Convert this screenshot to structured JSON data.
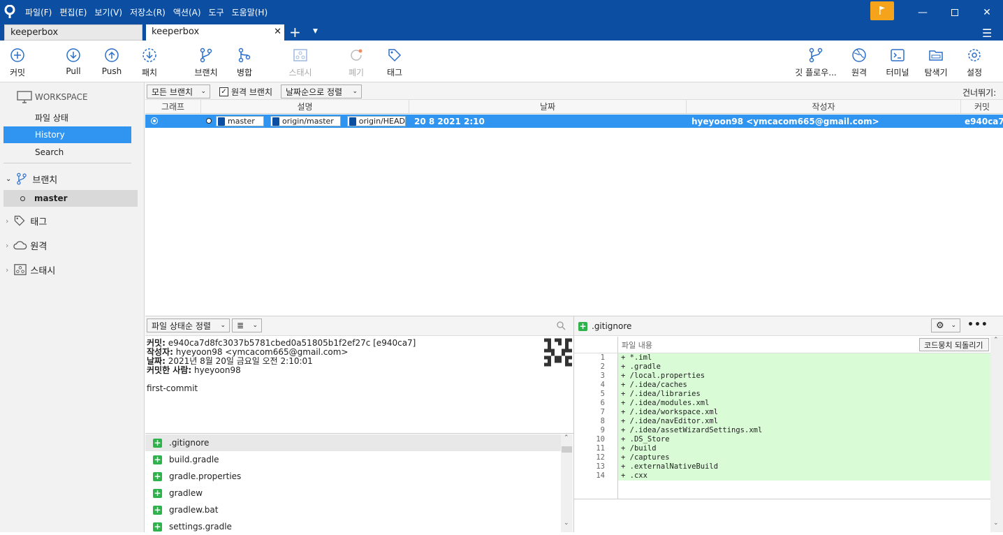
{
  "menu": [
    "파일(F)",
    "편집(E)",
    "보기(V)",
    "저장소(R)",
    "액션(A)",
    "도구",
    "도움말(H)"
  ],
  "tabs": [
    {
      "label": "keeperbox"
    },
    {
      "label": "keeperbox"
    }
  ],
  "toolbar": {
    "commit": "커밋",
    "pull": "Pull",
    "push": "Push",
    "patch": "패치",
    "branch": "브랜치",
    "merge": "병합",
    "stash": "스태시",
    "discard": "폐기",
    "tag": "태그",
    "gitflow": "깃 플로우...",
    "remote": "원격",
    "terminal": "터미널",
    "explorer": "탐색기",
    "settings": "설정"
  },
  "sidebar": {
    "workspace": "WORKSPACE",
    "file_status": "파일 상태",
    "history": "History",
    "search": "Search",
    "branches": "브랜치",
    "master": "master",
    "tags": "태그",
    "remotes": "원격",
    "stashes": "스태시"
  },
  "filter": {
    "branches": "모든 브랜치",
    "remote_branches": "원격 브랜치",
    "sort": "날짜순으로 정렬",
    "skip": "건너뛰기:"
  },
  "columns": {
    "graph": "그래프",
    "description": "설명",
    "date": "날짜",
    "author": "작성자",
    "commit": "커밋"
  },
  "commit_row": {
    "refs": [
      "master",
      "origin/master",
      "origin/HEAD"
    ],
    "date": "20 8 2021 2:10",
    "author": "hyeyoon98 <ymcacom665@gmail.com>",
    "hash": "e940ca7"
  },
  "lower_toolbar": {
    "sort": "파일 상태순 정렬",
    "view": "≣"
  },
  "detail": {
    "commit_label": "커밋:",
    "commit_value": " e940ca7d8fc3037b5781cbed0a51805b1f2ef27c [e940ca7]",
    "author_label": "작성자:",
    "author_value": " hyeyoon98 <ymcacom665@gmail.com>",
    "date_label": "날짜:",
    "date_value": " 2021년 8월 20일 금요일 오전 2:10:01",
    "committer_label": "커밋한 사람:",
    "committer_value": " hyeyoon98",
    "message": "first-commit"
  },
  "files": [
    ".gitignore",
    "build.gradle",
    "gradle.properties",
    "gradlew",
    "gradlew.bat",
    "settings.gradle"
  ],
  "diff": {
    "filename": ".gitignore",
    "hunk_label": "파일 내용",
    "revert": "코드뭉치 되돌리기",
    "lines": [
      {
        "n": "1",
        "t": "+ *.iml"
      },
      {
        "n": "2",
        "t": "+ .gradle"
      },
      {
        "n": "3",
        "t": "+ /local.properties"
      },
      {
        "n": "4",
        "t": "+ /.idea/caches"
      },
      {
        "n": "5",
        "t": "+ /.idea/libraries"
      },
      {
        "n": "6",
        "t": "+ /.idea/modules.xml"
      },
      {
        "n": "7",
        "t": "+ /.idea/workspace.xml"
      },
      {
        "n": "8",
        "t": "+ /.idea/navEditor.xml"
      },
      {
        "n": "9",
        "t": "+ /.idea/assetWizardSettings.xml"
      },
      {
        "n": "10",
        "t": "+ .DS_Store"
      },
      {
        "n": "11",
        "t": "+ /build"
      },
      {
        "n": "12",
        "t": "+ /captures"
      },
      {
        "n": "13",
        "t": "+ .externalNativeBuild"
      },
      {
        "n": "14",
        "t": "+ .cxx"
      }
    ]
  }
}
